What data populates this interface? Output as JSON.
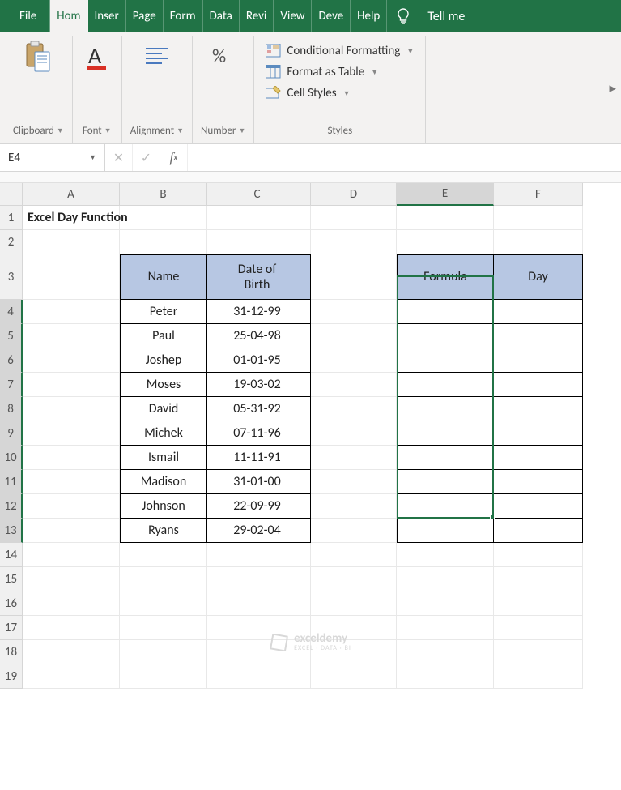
{
  "tabs": {
    "file": "File",
    "home": "Hom",
    "insert": "Inser",
    "page": "Page",
    "formulas": "Form",
    "data": "Data",
    "review": "Revi",
    "view": "View",
    "developer": "Deve",
    "help": "Help",
    "tellme": "Tell me"
  },
  "ribbon": {
    "clipboard": "Clipboard",
    "font": "Font",
    "alignment": "Alignment",
    "number": "Number",
    "styles_title": "Styles",
    "cond_fmt": "Conditional Formatting",
    "fmt_table": "Format as Table",
    "cell_styles": "Cell Styles"
  },
  "namebox": "E4",
  "formula": "",
  "columns": [
    "A",
    "B",
    "C",
    "D",
    "E",
    "F"
  ],
  "rownums": [
    1,
    2,
    3,
    4,
    5,
    6,
    7,
    8,
    9,
    10,
    11,
    12,
    13,
    14,
    15,
    16,
    17,
    18,
    19
  ],
  "title": "Excel Day Function",
  "table1": {
    "h1": "Name",
    "h2": "Date of Birth",
    "rows": [
      {
        "n": "Peter",
        "d": "31-12-99"
      },
      {
        "n": "Paul",
        "d": "25-04-98"
      },
      {
        "n": "Joshep",
        "d": "01-01-95"
      },
      {
        "n": "Moses",
        "d": "19-03-02"
      },
      {
        "n": "David",
        "d": "05-31-92"
      },
      {
        "n": "Michek",
        "d": "07-11-96"
      },
      {
        "n": "Ismail",
        "d": "11-11-91"
      },
      {
        "n": "Madison",
        "d": "31-01-00"
      },
      {
        "n": "Johnson",
        "d": "22-09-99"
      },
      {
        "n": "Ryans",
        "d": "29-02-04"
      }
    ]
  },
  "table2": {
    "h1": "Formula",
    "h2": "Day"
  },
  "watermark": {
    "name": "exceldemy",
    "sub": "EXCEL · DATA · BI"
  }
}
